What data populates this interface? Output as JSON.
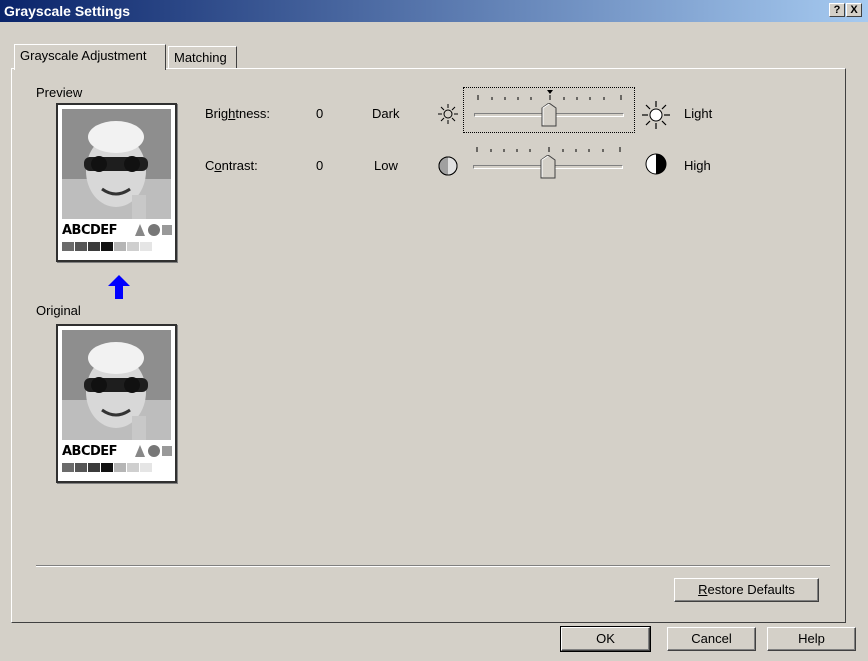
{
  "window": {
    "title": "Grayscale Settings",
    "help_button": "?",
    "close_button": "X"
  },
  "tabs": [
    {
      "label": "Grayscale Adjustment",
      "active": true
    },
    {
      "label": "Matching",
      "active": false
    }
  ],
  "preview": {
    "label": "Preview",
    "sample_text": "ABCDEF"
  },
  "original": {
    "label": "Original",
    "sample_text": "ABCDEF"
  },
  "brightness": {
    "label_pre": "Brig",
    "label_accel": "h",
    "label_post": "tness:",
    "value": "0",
    "min_label": "Dark",
    "max_label": "Light",
    "min_icon": "dim-sun-icon",
    "max_icon": "bright-sun-icon"
  },
  "contrast": {
    "label_pre": "C",
    "label_accel": "o",
    "label_post": "ntrast:",
    "value": "0",
    "min_label": "Low",
    "max_label": "High",
    "min_icon": "low-contrast-icon",
    "max_icon": "high-contrast-icon"
  },
  "restore_defaults": {
    "accel": "R",
    "rest": "estore Defaults"
  },
  "footer": {
    "ok_label": "OK",
    "cancel_label": "Cancel",
    "help_label": "Help"
  },
  "colors": {
    "title_bar_start": "#0a246a",
    "title_bar_end": "#a6caf0",
    "dialog_background": "#d4d0c8",
    "arrow": "#0000ff"
  }
}
